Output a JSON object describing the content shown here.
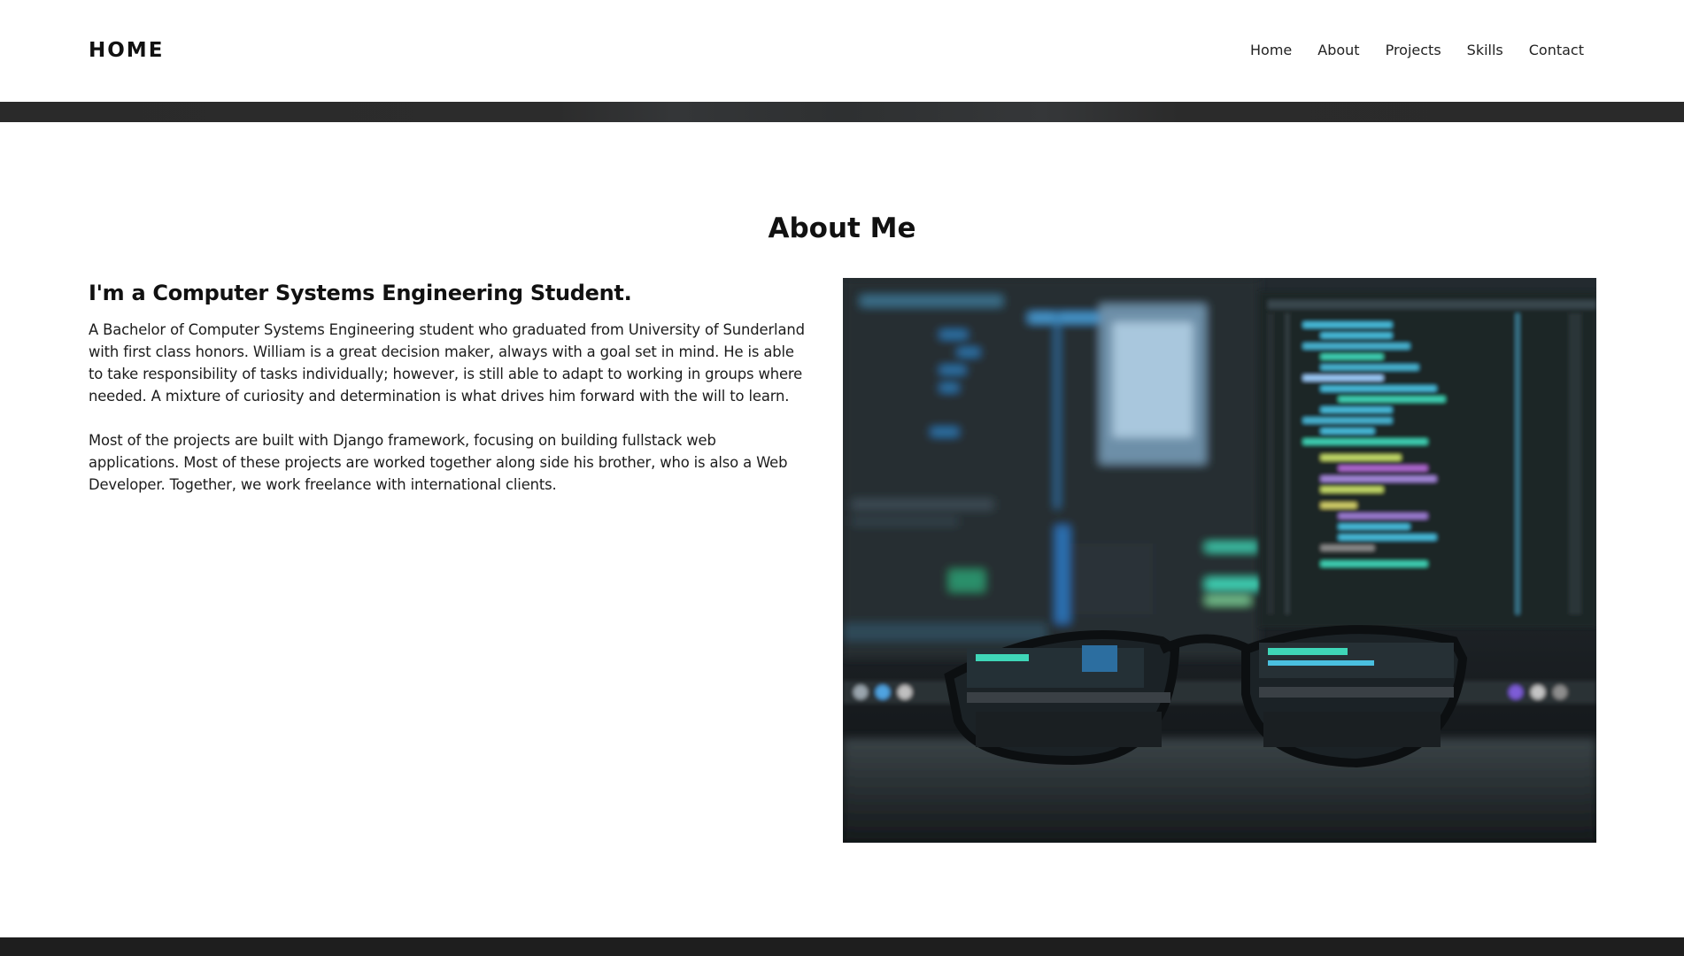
{
  "header": {
    "brand": "HOME",
    "nav": [
      {
        "label": "Home"
      },
      {
        "label": "About"
      },
      {
        "label": "Projects"
      },
      {
        "label": "Skills"
      },
      {
        "label": "Contact"
      }
    ]
  },
  "about": {
    "title": "About Me",
    "subtitle": "I'm a Computer Systems Engineering Student.",
    "paragraph1": "A Bachelor of Computer Systems Engineering student who graduated from University of Sunderland with first class honors. William is a great decision maker, always with a goal set in mind. He is able to take responsibility of tasks individually; however, is still able to adapt to working in groups where needed. A mixture of curiosity and determination is what drives him forward with the will to learn.",
    "paragraph2": "Most of the projects are built with Django framework, focusing on building fullstack web applications. Most of these projects are worked together along side his brother, who is also a Web Developer. Together, we work freelance with international clients."
  },
  "colors": {
    "text": "#111111",
    "background": "#ffffff",
    "dark_strip": "#2a2a2a",
    "accent_teal": "#3fd6b8"
  }
}
